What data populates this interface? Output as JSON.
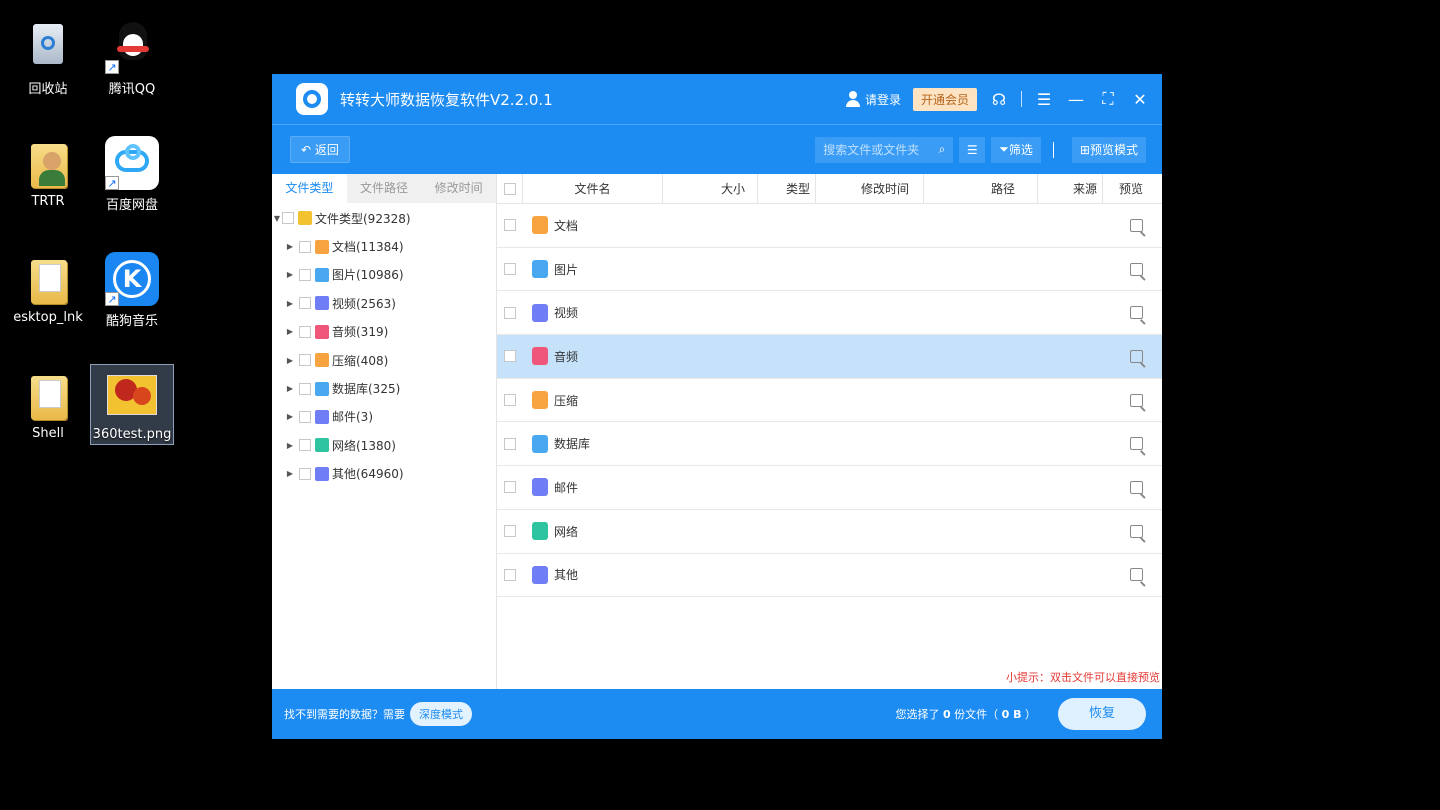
{
  "desktop": {
    "icons": [
      {
        "label": "回收站"
      },
      {
        "label": "腾讯QQ"
      },
      {
        "label": "TRTR"
      },
      {
        "label": "百度网盘"
      },
      {
        "label": "esktop_lnk"
      },
      {
        "label": "酷狗音乐"
      },
      {
        "label": "Shell"
      },
      {
        "label": "360test.png"
      }
    ]
  },
  "window": {
    "title": "转转大师数据恢复软件V2.2.0.1",
    "login": "请登录",
    "vip": "开通会员",
    "back": "返回",
    "search_placeholder": "搜索文件或文件夹",
    "filter": "筛选",
    "preview_mode": "预览模式"
  },
  "left_tabs": [
    "文件类型",
    "文件路径",
    "修改时间"
  ],
  "tree": {
    "root": "文件类型(92328)",
    "items": [
      {
        "label": "文档(11384)",
        "color": "#f7a440"
      },
      {
        "label": "图片(10986)",
        "color": "#4aa8f0"
      },
      {
        "label": "视频(2563)",
        "color": "#6f7ef5"
      },
      {
        "label": "音频(319)",
        "color": "#f0557a"
      },
      {
        "label": "压缩(408)",
        "color": "#f7a440"
      },
      {
        "label": "数据库(325)",
        "color": "#4aa8f0"
      },
      {
        "label": "邮件(3)",
        "color": "#6f7ef5"
      },
      {
        "label": "网络(1380)",
        "color": "#2ec4a0"
      },
      {
        "label": "其他(64960)",
        "color": "#6f7ef5"
      }
    ]
  },
  "columns": [
    "文件名",
    "大小",
    "类型",
    "修改时间",
    "路径",
    "来源",
    "预览"
  ],
  "rows": [
    {
      "label": "文档",
      "color": "#f7a440"
    },
    {
      "label": "图片",
      "color": "#4aa8f0"
    },
    {
      "label": "视频",
      "color": "#6f7ef5"
    },
    {
      "label": "音频",
      "color": "#f0557a"
    },
    {
      "label": "压缩",
      "color": "#f7a440"
    },
    {
      "label": "数据库",
      "color": "#4aa8f0"
    },
    {
      "label": "邮件",
      "color": "#6f7ef5"
    },
    {
      "label": "网络",
      "color": "#2ec4a0"
    },
    {
      "label": "其他",
      "color": "#6f7ef5"
    }
  ],
  "tip": "小提示：双击文件可以直接预览",
  "footer": {
    "prompt": "找不到需要的数据？需要",
    "deep_mode": "深度模式",
    "sel_prefix": "您选择了",
    "sel_count": "0",
    "sel_mid": "份文件（",
    "sel_size": "0 B",
    "sel_suffix": "）",
    "restore": "恢复"
  }
}
